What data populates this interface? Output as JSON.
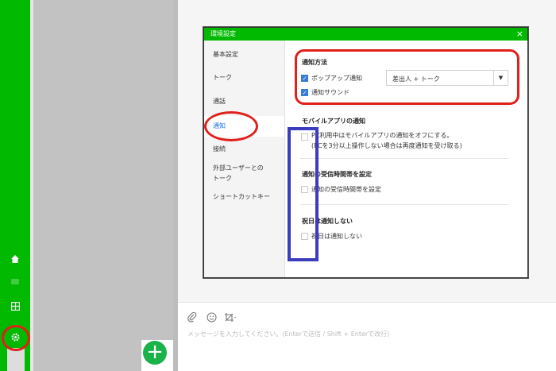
{
  "rail": {
    "icons": [
      "home-icon",
      "chat-icon",
      "apps-grid-icon",
      "settings-gear-icon"
    ]
  },
  "dialog": {
    "title": "環境設定",
    "close_glyph": "×",
    "nav": [
      "基本設定",
      "トーク",
      "通話",
      "通知",
      "接続",
      "外部ユーザーとの",
      "トーク",
      "ショートカットキー"
    ],
    "notify_method": {
      "title": "通知方法",
      "popup_label": "ポップアップ通知",
      "popup_checked": true,
      "sound_label": "通知サウンド",
      "sound_checked": true,
      "select_value": "差出人 + トーク",
      "select_arrow": "▼"
    },
    "mobile": {
      "title": "モバイルアプリの通知",
      "line1": "PC利用中はモバイルアプリの通知をオフにする。",
      "line2": "(PCを3分以上操作しない場合は再度通知を受け取る)"
    },
    "receive_time": {
      "title": "通知の受信時間帯を設定",
      "label": "通知の受信時間帯を設定"
    },
    "holiday": {
      "title": "祝日は通知しない",
      "label": "祝日は通知しない"
    }
  },
  "chat": {
    "message_placeholder": "メッセージを入力してください。(Enterで送信 / Shift + Enterで改行)"
  },
  "fab": {
    "glyph": "+"
  },
  "colors": {
    "line_green": "#00b900",
    "annotation_red": "#e0201a",
    "annotation_blue": "#3c3cbe",
    "active_blue": "#1a73e8"
  }
}
